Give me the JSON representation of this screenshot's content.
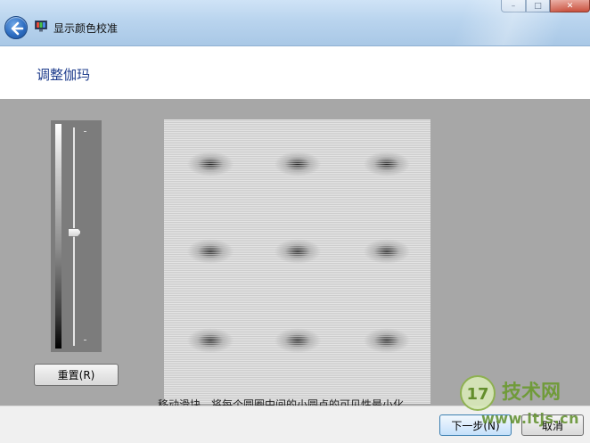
{
  "window": {
    "title": "显示颜色校准",
    "controls": {
      "minimize": "–",
      "maximize": "□",
      "close": "✕"
    }
  },
  "icons": {
    "back": "back-arrow-icon",
    "app": "monitor-color-icon",
    "slider_thumb": "slider-thumb-icon"
  },
  "header": {
    "title": "调整伽玛"
  },
  "gamma_slider": {
    "level": 0.52,
    "reset_label": "重置(R)"
  },
  "pattern": {
    "rows": 3,
    "cols": 3
  },
  "instruction_text": "移动滑块，将每个圆圈中间的小圆点的可见性最小化。",
  "footer": {
    "next_label": "下一步(N)",
    "cancel_label": "取消"
  },
  "watermark": {
    "logo_text": "17",
    "brand": "技术网",
    "url": "www.itjs.cn"
  },
  "colors": {
    "accent_title": "#1e3c8c",
    "panel_gray": "#a7a7a7",
    "watermark_green": "#6b9a2f"
  }
}
